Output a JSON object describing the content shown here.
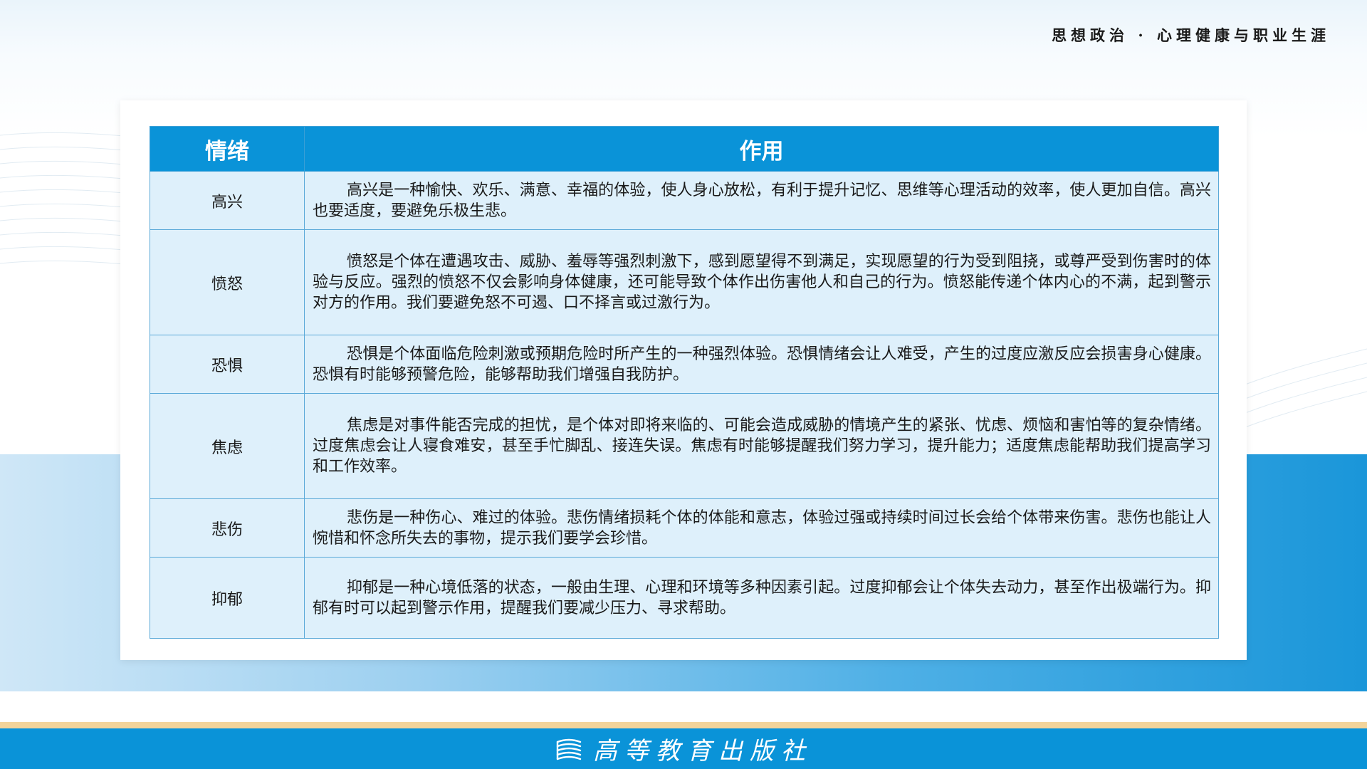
{
  "header": {
    "title": "思想政治 · 心理健康与职业生涯"
  },
  "table": {
    "columns": [
      "情绪",
      "作用"
    ],
    "rows": [
      {
        "emotion": "高兴",
        "effect": "高兴是一种愉快、欢乐、满意、幸福的体验，使人身心放松，有利于提升记忆、思维等心理活动的效率，使人更加自信。高兴也要适度，要避免乐极生悲。"
      },
      {
        "emotion": "愤怒",
        "effect": "愤怒是个体在遭遇攻击、威胁、羞辱等强烈刺激下，感到愿望得不到满足，实现愿望的行为受到阻挠，或尊严受到伤害时的体验与反应。强烈的愤怒不仅会影响身体健康，还可能导致个体作出伤害他人和自己的行为。愤怒能传递个体内心的不满，起到警示对方的作用。我们要避免怒不可遏、口不择言或过激行为。"
      },
      {
        "emotion": "恐惧",
        "effect": "恐惧是个体面临危险刺激或预期危险时所产生的一种强烈体验。恐惧情绪会让人难受，产生的过度应激反应会损害身心健康。恐惧有时能够预警危险，能够帮助我们增强自我防护。"
      },
      {
        "emotion": "焦虑",
        "effect": "焦虑是对事件能否完成的担忧，是个体对即将来临的、可能会造成威胁的情境产生的紧张、忧虑、烦恼和害怕等的复杂情绪。过度焦虑会让人寝食难安，甚至手忙脚乱、接连失误。焦虑有时能够提醒我们努力学习，提升能力；适度焦虑能帮助我们提高学习和工作效率。"
      },
      {
        "emotion": "悲伤",
        "effect": "悲伤是一种伤心、难过的体验。悲伤情绪损耗个体的体能和意志，体验过强或持续时间过长会给个体带来伤害。悲伤也能让人惋惜和怀念所失去的事物，提示我们要学会珍惜。"
      },
      {
        "emotion": "抑郁",
        "effect": "抑郁是一种心境低落的状态，一般由生理、心理和环境等多种因素引起。过度抑郁会让个体失去动力，甚至作出极端行为。抑郁有时可以起到警示作用，提醒我们要减少压力、寻求帮助。"
      }
    ]
  },
  "footer": {
    "publisher": "高等教育出版社",
    "logo_icon": "book-stack-icon"
  },
  "colors": {
    "header_blue": "#0a93d8",
    "cell_bg": "#def0fb",
    "gold_stripe": "#f3d49a"
  }
}
